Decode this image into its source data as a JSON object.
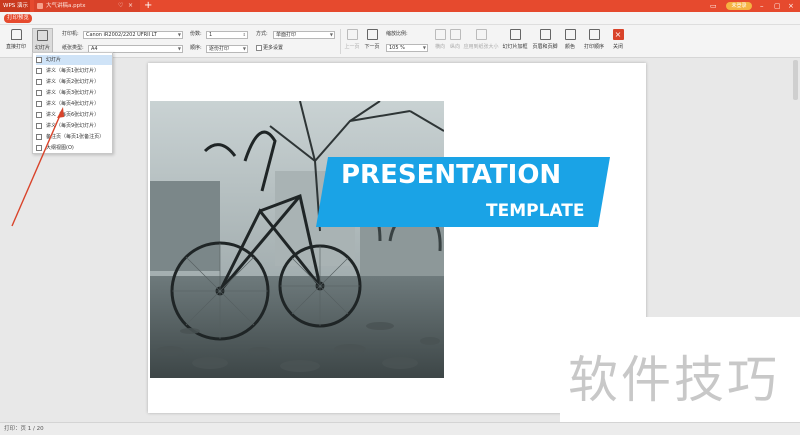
{
  "titlebar": {
    "app_name": "WPS 演示",
    "doc_tab": "大气讲稿a.pptx",
    "tab_pin": "♡",
    "tab_close": "×",
    "new_tab": "+",
    "login": "未登录",
    "win_min": "–",
    "win_max": "▢",
    "win_close": "×",
    "win_icon": "▭"
  },
  "modebar": {
    "mode_label": "打印预览"
  },
  "toolbar": {
    "direct_print": "直接打印",
    "slides": "幻灯片",
    "printer_label": "打印机:",
    "printer_value": "Canon iR2002/2202 UFRII LT",
    "paper_label": "纸张类型:",
    "paper_value": "A4",
    "copies_label": "份数:",
    "copies_value": "1",
    "order_label": "顺序:",
    "order_value": "逐份打印",
    "method_label": "方式:",
    "method_value": "单面打印",
    "more_settings": "更多设置",
    "prev_page": "上一页",
    "next_page": "下一页",
    "zoom_label": "缩放比例:",
    "zoom_value": "105 %",
    "landscape": "横向",
    "portrait": "纵向",
    "scale_to_paper": "应用到纸张大小",
    "slide_frame": "幻灯片加框",
    "header_footer": "页眉和页脚",
    "color": "颜色",
    "print_order": "打印顺序",
    "close": "关闭"
  },
  "dropdown": {
    "items": [
      "幻灯片",
      "讲义（每页1张幻灯片）",
      "讲义（每页2张幻灯片）",
      "讲义（每页3张幻灯片）",
      "讲义（每页4张幻灯片）",
      "讲义（每页6张幻灯片）",
      "讲义（每页9张幻灯片）",
      "备注页（每页1张备注页）",
      "大纲视图(O)"
    ],
    "selected_index": 0
  },
  "slide": {
    "title": "PRESENTATION",
    "subtitle": "TEMPLATE",
    "banner_color": "#1aa3e6",
    "background": "#ffffff"
  },
  "statusbar": {
    "page_info": "打印：页 1 / 20"
  },
  "watermark": {
    "text": "软件技巧"
  },
  "colors": {
    "brand": "#e64a2e",
    "toolbar_bg": "#f4f4f4",
    "accent_blue": "#1aa3e6",
    "annotation_arrow": "#d9432a"
  }
}
